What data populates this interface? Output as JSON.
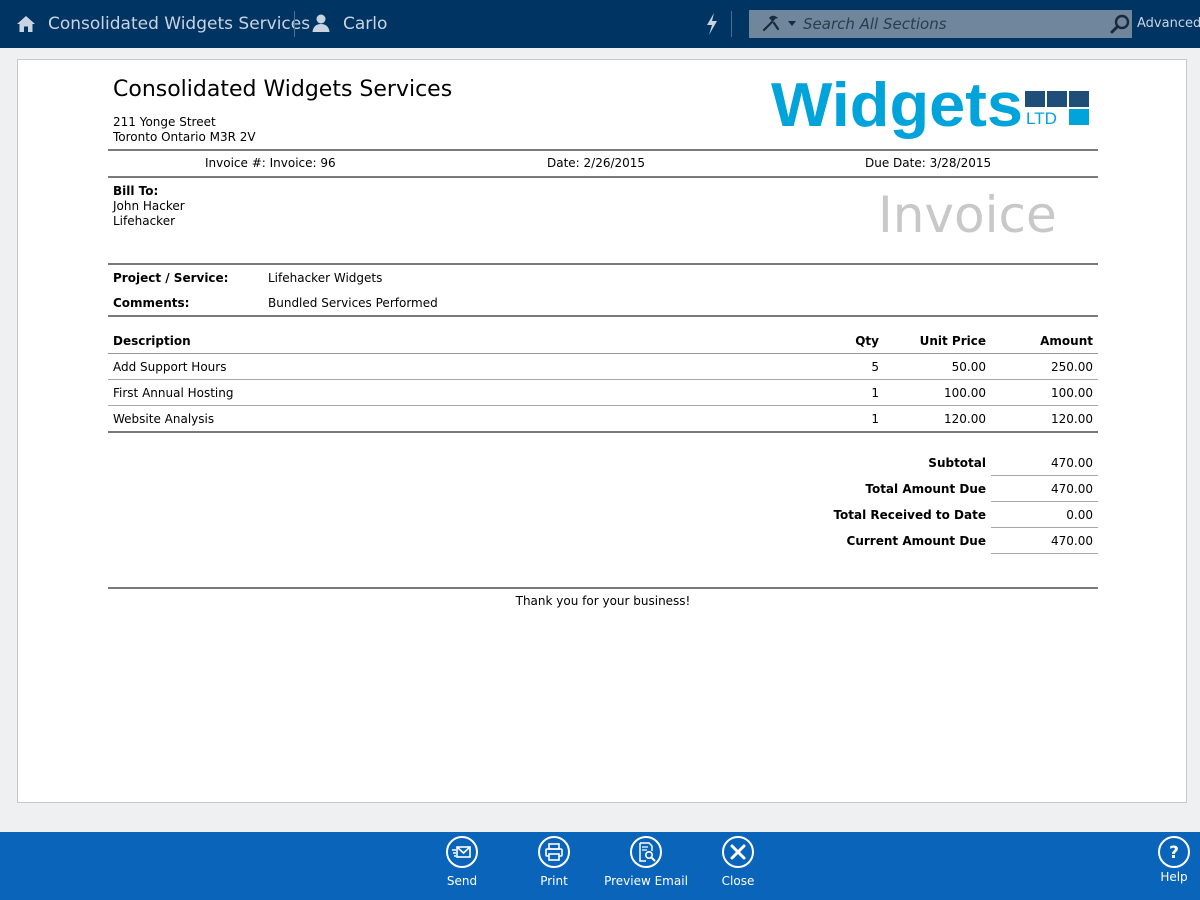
{
  "topbar": {
    "company": "Consolidated Widgets Services",
    "user": "Carlo",
    "search_placeholder": "Search All Sections",
    "advanced_label": "Advanced"
  },
  "invoice": {
    "company_name": "Consolidated Widgets Services",
    "address_line1": "211 Yonge Street",
    "address_line2": "Toronto Ontario M3R 2V",
    "logo": {
      "word": "Widgets",
      "suffix": "LTD"
    },
    "invoice_number": "Invoice #: Invoice: 96",
    "date": "Date: 2/26/2015",
    "due_date": "Due Date: 3/28/2015",
    "bill_to_label": "Bill To:",
    "bill_to_name": "John Hacker",
    "bill_to_company": "Lifehacker",
    "title": "Invoice",
    "project_label": "Project / Service:",
    "project_value": "Lifehacker Widgets",
    "comments_label": "Comments:",
    "comments_value": "Bundled Services Performed",
    "columns": {
      "description": "Description",
      "qty": "Qty",
      "unit_price": "Unit Price",
      "amount": "Amount"
    },
    "items": [
      {
        "description": "Add Support Hours",
        "qty": "5",
        "unit_price": "50.00",
        "amount": "250.00"
      },
      {
        "description": "First Annual Hosting",
        "qty": "1",
        "unit_price": "100.00",
        "amount": "100.00"
      },
      {
        "description": "Website Analysis",
        "qty": "1",
        "unit_price": "120.00",
        "amount": "120.00"
      }
    ],
    "totals": [
      {
        "label": "Subtotal",
        "value": "470.00"
      },
      {
        "label": "Total Amount Due",
        "value": "470.00"
      },
      {
        "label": "Total Received to Date",
        "value": "0.00"
      },
      {
        "label": "Current Amount Due",
        "value": "470.00"
      }
    ],
    "footer_note": "Thank you for your business!"
  },
  "toolbar": {
    "send": "Send",
    "print": "Print",
    "preview_email": "Preview Email",
    "close": "Close",
    "help": "Help"
  },
  "colors": {
    "topbar_bg": "#003462",
    "bottombar_bg": "#0a64b9",
    "logo_cyan": "#00a3da",
    "logo_navy": "#1f4e79"
  }
}
